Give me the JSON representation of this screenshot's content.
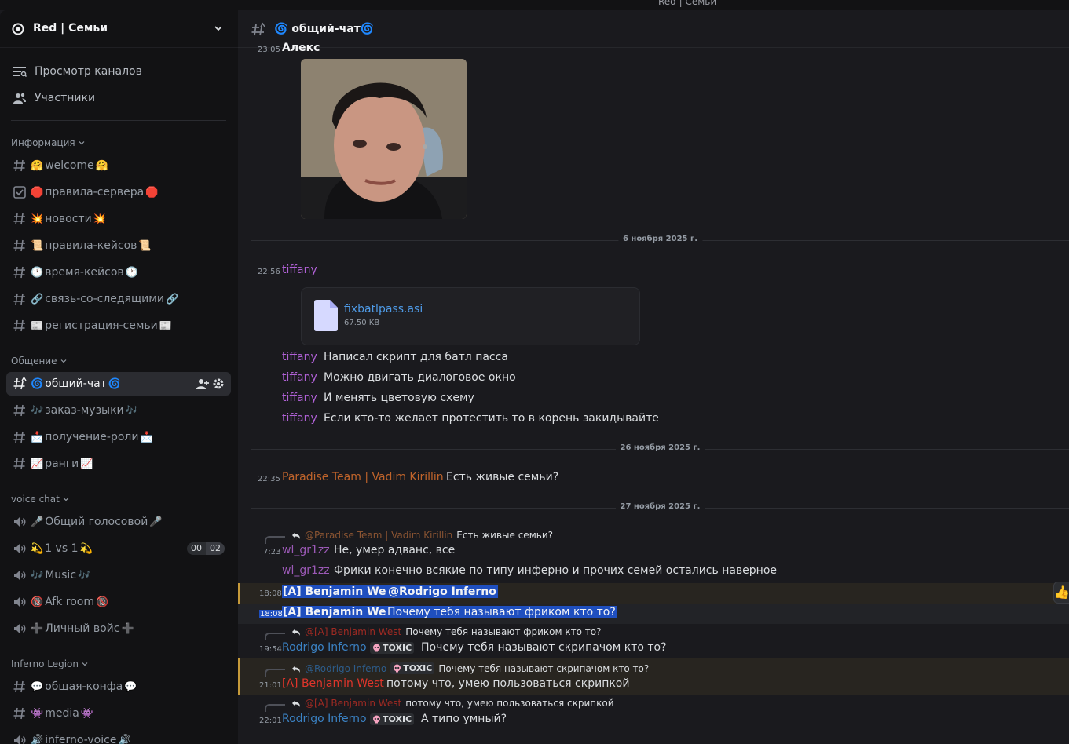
{
  "window": {
    "title": "Red | Семьи"
  },
  "sidebar": {
    "guild_name": "Red | Семьи",
    "nav": [
      {
        "label": "Просмотр каналов",
        "icon": "browse-channels-icon"
      },
      {
        "label": "Участники",
        "icon": "members-icon"
      }
    ],
    "categories": [
      {
        "name": "Информация",
        "channels": [
          {
            "pre": "🤗",
            "name": "welcome",
            "post": "🤗"
          },
          {
            "pre": "🛑",
            "name": "правила-сервера",
            "post": "🛑"
          },
          {
            "pre": "💥",
            "name": "новости",
            "post": "💥"
          },
          {
            "pre": "📜",
            "name": "правила-кейсов",
            "post": "📜"
          },
          {
            "pre": "🕐",
            "name": "время-кейсов",
            "post": "🕐"
          },
          {
            "pre": "🔗",
            "name": "связь-со-следящими",
            "post": "🔗"
          },
          {
            "pre": "📰",
            "name": "регистрация-семьи",
            "post": "📰"
          }
        ]
      },
      {
        "name": "Общение",
        "channels": [
          {
            "pre": "🌀",
            "name": "общий-чат",
            "post": "🌀",
            "active": true
          },
          {
            "pre": "🎶",
            "name": "заказ-музыки",
            "post": "🎶"
          },
          {
            "pre": "📩",
            "name": "получение-роли",
            "post": "📩"
          },
          {
            "pre": "📈",
            "name": "ранги",
            "post": "📈"
          }
        ]
      },
      {
        "name": "voice chat",
        "channels": [
          {
            "pre": "🎤",
            "name": "Общий голосовой",
            "post": "🎤"
          },
          {
            "pre": "💫",
            "name": "1 vs 1",
            "post": "💫",
            "badge": [
              "00",
              "02"
            ]
          },
          {
            "pre": "🎶",
            "name": "Music",
            "post": "🎶"
          },
          {
            "pre": "🔞",
            "name": "Afk room",
            "post": "🔞"
          },
          {
            "pre": "➕",
            "name": "Личный войс",
            "post": "➕"
          }
        ]
      },
      {
        "name": "Inferno Legion",
        "channels": [
          {
            "pre": "💬",
            "name": "общая-конфа",
            "post": "💬"
          },
          {
            "pre": "👾",
            "name": "media",
            "post": "👾"
          },
          {
            "pre": "🔊",
            "name": "inferno-voice",
            "post": "🔊"
          }
        ]
      }
    ]
  },
  "header": {
    "pre": "🌀",
    "channel": "общий-чат",
    "post": "🌀"
  },
  "messages": {
    "m0": {
      "time": "23:05",
      "author": "Алекс"
    },
    "d1": "6 ноября 2025 г.",
    "m1": {
      "time": "22:56",
      "author": "tiffany",
      "file_name": "fixbatlpass.asi",
      "file_size": "67.50 KB"
    },
    "m2": {
      "author": "tiffany",
      "text": "Написал скрипт для батл пасса"
    },
    "m3": {
      "author": "tiffany",
      "text": "Можно двигать диалоговое окно"
    },
    "m4": {
      "author": "tiffany",
      "text": "И менять цветовую схему"
    },
    "m5": {
      "author": "tiffany",
      "text": "Если кто-то желает протестить то в корень закидывайте"
    },
    "d2": "26 ноября 2025 г.",
    "m6": {
      "time": "22:35",
      "author": "Paradise Team | Vadim Kirillin",
      "text": "Есть живые семьи?"
    },
    "d3": "27 ноября 2025 г.",
    "m7": {
      "reply_user": "@Paradise Team | Vadim Kirillin",
      "reply_text": "Есть живые семьи?",
      "time": "7:23",
      "author": "wl_gr1zz",
      "text": "Не, умер адванс, все"
    },
    "m8": {
      "author": "wl_gr1zz",
      "text": "Фрики конечно всякие по типу инферно и прочих семей остались наверное"
    },
    "m9": {
      "time": "18:08",
      "author": "[A] Benjamin West",
      "mention": "@Rodrigo Inferno"
    },
    "m10": {
      "time": "18:08",
      "author": "[A] Benjamin West",
      "text": "Почему тебя называют фриком кто то?"
    },
    "m11": {
      "reply_user": "@[A] Benjamin West",
      "reply_text": "Почему тебя называют фриком кто то?",
      "time": "19:54",
      "author": "Rodrigo Inferno",
      "tag": "TOXIC",
      "text": "Почему тебя называют скрипачом кто то?"
    },
    "m12": {
      "reply_user": "@Rodrigo Inferno",
      "reply_tag": "TOXIC",
      "reply_text": "Почему тебя называют скрипачом кто то?",
      "time": "21:01",
      "author": "[A] Benjamin West",
      "text": "потому что, умею пользоваться скрипкой"
    },
    "m13": {
      "reply_user": "@[A] Benjamin West",
      "reply_text": "потому что, умею пользоваться скрипкой",
      "time": "22:01",
      "author": "Rodrigo Inferno",
      "tag": "TOXIC",
      "text": "А типо умный?"
    }
  },
  "colors": {
    "tiffany": "#b061d6",
    "paradise": "#c0642b",
    "wl_gr1zz": "#9b59b6",
    "benjamin": "#e0352b",
    "rodrigo": "#3b82c4",
    "link": "#4e9ae6"
  },
  "reaction": "👍"
}
